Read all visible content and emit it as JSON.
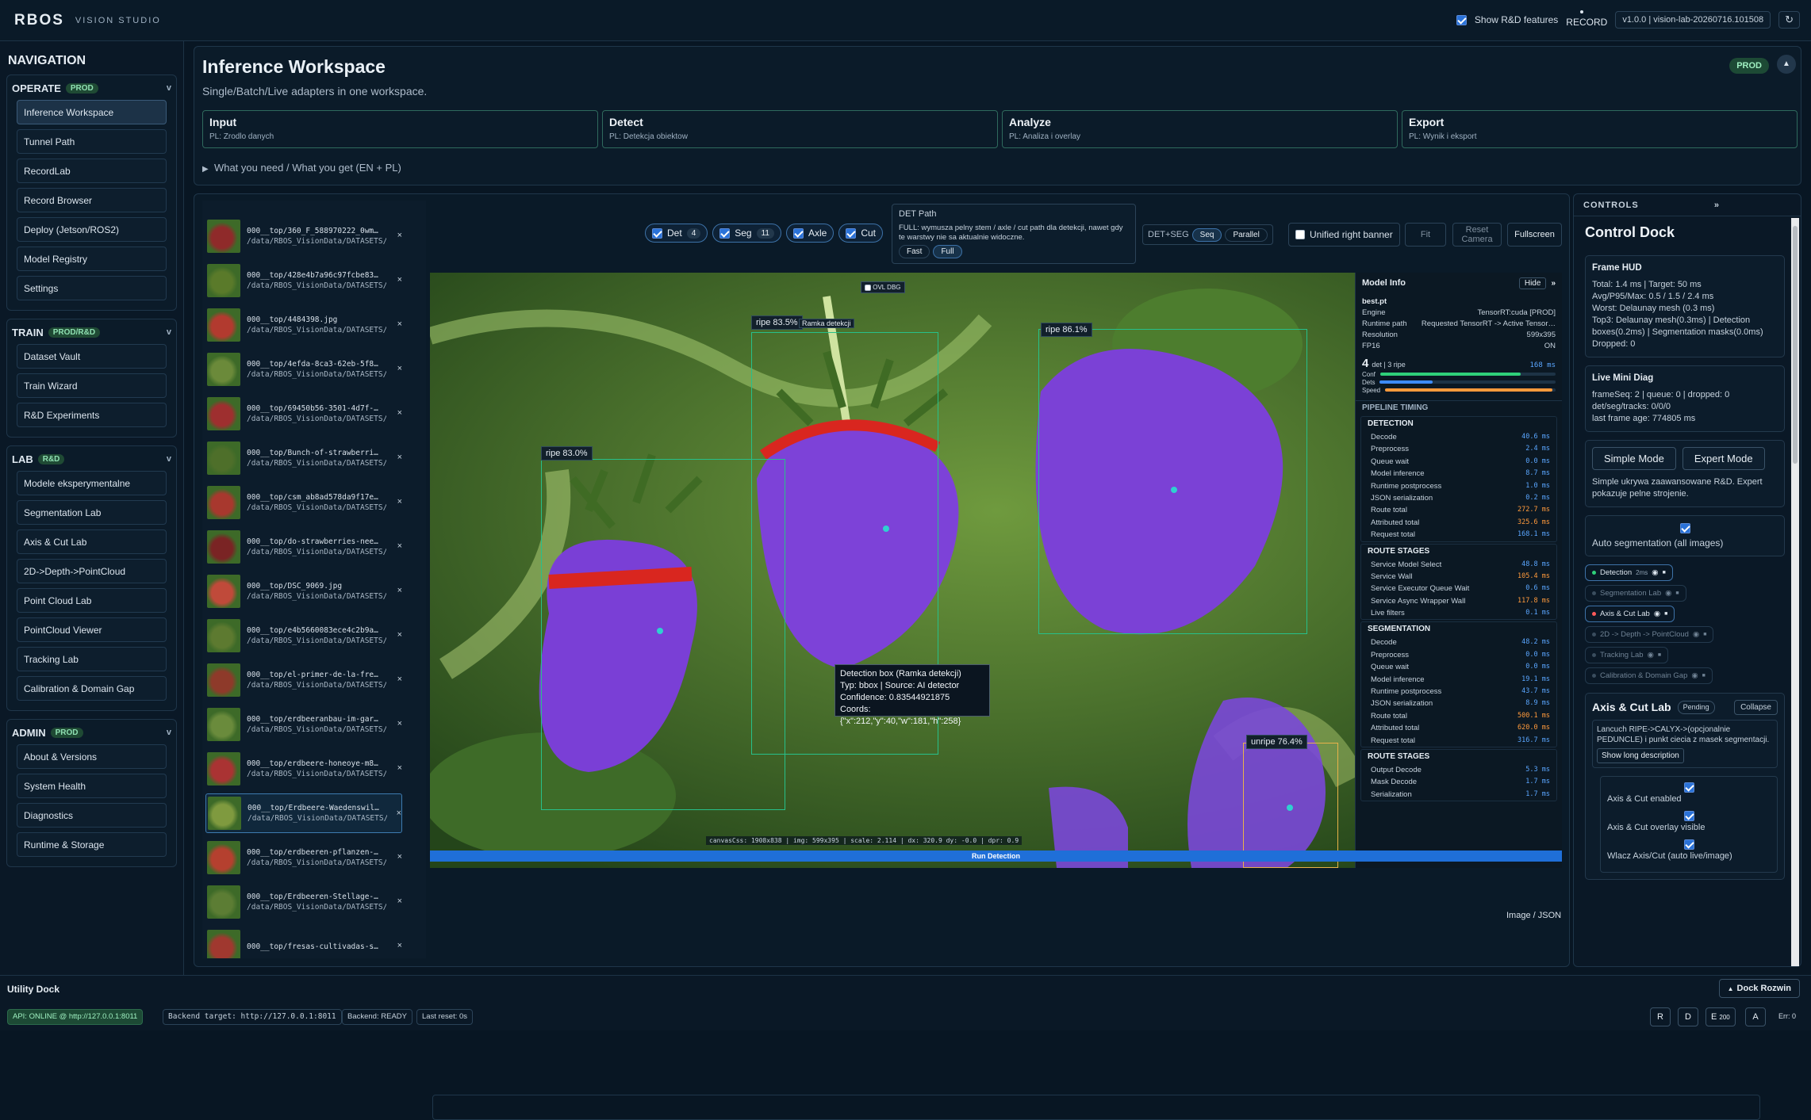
{
  "app": {
    "logo": "RBOS",
    "subtitle": "VISION STUDIO",
    "show_rd": "Show R&D features",
    "record": "RECORD",
    "version": "v1.0.0 | vision-lab-20260716.101508"
  },
  "nav": {
    "title": "NAVIGATION",
    "groups": [
      {
        "label": "OPERATE",
        "badge": "PROD",
        "items": [
          "Inference Workspace",
          "Tunnel Path",
          "RecordLab",
          "Record Browser",
          "Deploy (Jetson/ROS2)",
          "Model Registry",
          "Settings"
        ]
      },
      {
        "label": "TRAIN",
        "badge": "PROD/R&D",
        "items": [
          "Dataset Vault",
          "Train Wizard",
          "R&D Experiments"
        ]
      },
      {
        "label": "LAB",
        "badge": "R&D",
        "items": [
          "Modele eksperymentalne",
          "Segmentation Lab",
          "Axis & Cut Lab",
          "2D->Depth->PointCloud",
          "Point Cloud Lab",
          "PointCloud Viewer",
          "Tracking Lab",
          "Calibration & Domain Gap"
        ]
      },
      {
        "label": "ADMIN",
        "badge": "PROD",
        "items": [
          "About & Versions",
          "System Health",
          "Diagnostics",
          "Runtime & Storage"
        ]
      }
    ]
  },
  "workspace": {
    "title": "Inference Workspace",
    "subtitle": "Single/Batch/Live adapters in one workspace.",
    "badge": "PROD",
    "steps": [
      {
        "t": "Input",
        "s": "PL: Zrodlo danych"
      },
      {
        "t": "Detect",
        "s": "PL: Detekcja obiektow"
      },
      {
        "t": "Analyze",
        "s": "PL: Analiza i overlay"
      },
      {
        "t": "Export",
        "s": "PL: Wynik i eksport"
      }
    ],
    "details": "What you need / What you get (EN + PL)"
  },
  "files": [
    {
      "n": "000__top/360_F_588970222_0wm…",
      "p": "/data/RBOS_VisionData/DATASETS/…"
    },
    {
      "n": "000__top/428e4b7a96c97fcbe83…",
      "p": "/data/RBOS_VisionData/DATASETS/…"
    },
    {
      "n": "000__top/4484398.jpg",
      "p": "/data/RBOS_VisionData/DATASETS/…"
    },
    {
      "n": "000__top/4efda-8ca3-62eb-5f8…",
      "p": "/data/RBOS_VisionData/DATASETS/…"
    },
    {
      "n": "000__top/69450b56-3501-4d7f-…",
      "p": "/data/RBOS_VisionData/DATASETS/…"
    },
    {
      "n": "000__top/Bunch-of-strawberri…",
      "p": "/data/RBOS_VisionData/DATASETS/…"
    },
    {
      "n": "000__top/csm_ab8ad578da9f17e…",
      "p": "/data/RBOS_VisionData/DATASETS/…"
    },
    {
      "n": "000__top/do-strawberries-nee…",
      "p": "/data/RBOS_VisionData/DATASETS/…"
    },
    {
      "n": "000__top/DSC_9069.jpg",
      "p": "/data/RBOS_VisionData/DATASETS/…"
    },
    {
      "n": "000__top/e4b5660083ece4c2b9a…",
      "p": "/data/RBOS_VisionData/DATASETS/…"
    },
    {
      "n": "000__top/el-primer-de-la-fre…",
      "p": "/data/RBOS_VisionData/DATASETS/…"
    },
    {
      "n": "000__top/erdbeeranbau-im-gar…",
      "p": "/data/RBOS_VisionData/DATASETS/…"
    },
    {
      "n": "000__top/erdbeere-honeoye-m8…",
      "p": "/data/RBOS_VisionData/DATASETS/…"
    },
    {
      "n": "000__top/Erdbeere-Waedenswil…",
      "p": "/data/RBOS_VisionData/DATASETS/…"
    },
    {
      "n": "000__top/erdbeeren-pflanzen-…",
      "p": "/data/RBOS_VisionData/DATASETS/…"
    },
    {
      "n": "000__top/Erdbeeren-Stellage-…",
      "p": "/data/RBOS_VisionData/DATASETS/…"
    },
    {
      "n": "000__top/fresas-cultivadas-s…",
      "p": ""
    }
  ],
  "toolbar": {
    "det": "Det",
    "det_n": "4",
    "seg": "Seg",
    "seg_n": "11",
    "axle": "Axle",
    "cut": "Cut",
    "detpath_title": "DET Path",
    "detpath_desc": "FULL: wymusza pelny stem / axle / cut path dla detekcji, nawet gdy te warstwy nie sa aktualnie widoczne.",
    "fast": "Fast",
    "full": "Full",
    "mode": "DET+SEG",
    "seq": "Seq",
    "parallel": "Parallel",
    "unified": "Unified right banner",
    "fit": "Fit",
    "reset": "Reset Camera",
    "fullscreen": "Fullscreen"
  },
  "canvas": {
    "ovl": "OVL DBG",
    "labels": [
      "ripe 83.5%",
      "ripe 86.1%",
      "ripe 83.0%",
      "unripe 76.4%",
      "Ramka detekcji"
    ],
    "tooltip": [
      "Detection box (Ramka detekcji)",
      "Typ: bbox | Source: AI detector",
      "Confidence: 0.83544921875",
      "Coords: {\"x\":212,\"y\":40,\"w\":181,\"h\":258}"
    ],
    "diag": "canvasCss: 1908x838 | img: 599x395 | scale: 2.114 | dx: 320.9 dy: -0.0 | dpr: 0.9",
    "run": "Run Detection",
    "imgjson": "Image / JSON"
  },
  "model": {
    "title": "Model Info",
    "hide": "Hide",
    "file": "best.pt",
    "rows": [
      [
        "Engine",
        "TensorRT:cuda [PROD]"
      ],
      [
        "Runtime path",
        "Requested TensorRT -> Active Tensor…"
      ],
      [
        "Resolution",
        "599x395"
      ],
      [
        "FP16",
        "ON"
      ]
    ],
    "count": "4",
    "count_label": "det | 3 ripe",
    "count_ms": "168 ms",
    "bars": [
      "Conf",
      "Dets",
      "Speed"
    ],
    "pipeline": "PIPELINE TIMING",
    "detection": [
      [
        "Decode",
        "40.6 ms"
      ],
      [
        "Preprocess",
        "2.4 ms"
      ],
      [
        "Queue wait",
        "0.0 ms"
      ],
      [
        "Model inference",
        "8.7 ms"
      ],
      [
        "Runtime postprocess",
        "1.0 ms"
      ],
      [
        "JSON serialization",
        "0.2 ms"
      ],
      [
        "Route total",
        "272.7 ms"
      ],
      [
        "Attributed total",
        "325.6 ms"
      ],
      [
        "Request total",
        "168.1 ms"
      ]
    ],
    "route1": [
      [
        "Service Model Select",
        "48.8 ms"
      ],
      [
        "Service Wall",
        "105.4 ms"
      ],
      [
        "Service Executor Queue Wait",
        "0.6 ms"
      ],
      [
        "Service Async Wrapper Wall",
        "117.8 ms"
      ],
      [
        "Live filters",
        "0.1 ms"
      ]
    ],
    "segmentation": [
      [
        "Decode",
        "48.2 ms"
      ],
      [
        "Preprocess",
        "0.0 ms"
      ],
      [
        "Queue wait",
        "0.0 ms"
      ],
      [
        "Model inference",
        "19.1 ms"
      ],
      [
        "Runtime postprocess",
        "43.7 ms"
      ],
      [
        "JSON serialization",
        "8.9 ms"
      ],
      [
        "Route total",
        "500.1 ms"
      ],
      [
        "Attributed total",
        "620.0 ms"
      ],
      [
        "Request total",
        "316.7 ms"
      ]
    ],
    "route2": [
      [
        "Output Decode",
        "5.3 ms"
      ],
      [
        "Mask Decode",
        "1.7 ms"
      ],
      [
        "Serialization",
        "1.7 ms"
      ]
    ],
    "sec_det": "DETECTION",
    "sec_route": "ROUTE STAGES",
    "sec_seg": "SEGMENTATION"
  },
  "controls": {
    "head": "CONTROLS",
    "title": "Control Dock",
    "hud": {
      "t": "Frame HUD",
      "l": [
        "Total: 1.4 ms | Target: 50 ms",
        "Avg/P95/Max: 0.5 / 1.5 / 2.4 ms",
        "Worst: Delaunay mesh (0.3 ms)",
        "Top3: Delaunay mesh(0.3ms) | Detection boxes(0.2ms) | Segmentation masks(0.0ms)",
        "Dropped: 0"
      ]
    },
    "diag": {
      "t": "Live Mini Diag",
      "l": [
        "frameSeq: 2 | queue: 0 | dropped: 0",
        "det/seg/tracks: 0/0/0",
        "last frame age: 774805 ms"
      ]
    },
    "simple": "Simple Mode",
    "expert": "Expert Mode",
    "mode_desc": "Simple ukrywa zaawansowane R&D. Expert pokazuje pelne strojenie.",
    "autoseg": "Auto segmentation (all images)",
    "chips": [
      "Detection",
      "Segmentation Lab",
      "Axis & Cut Lab",
      "2D -> Depth -> PointCloud",
      "Tracking Lab",
      "Calibration & Domain Gap"
    ],
    "chip_ms": "2ms",
    "axis": {
      "t": "Axis & Cut Lab",
      "pending": "Pending",
      "collapse": "Collapse",
      "desc": "Lancuch RIPE->CALYX->(opcjonalnie PEDUNCLE) i punkt ciecia z masek segmentacji.",
      "long": "Show long description",
      "opts": [
        "Axis & Cut enabled",
        "Axis & Cut overlay visible",
        "Wlacz Axis/Cut (auto live/image)"
      ]
    }
  },
  "utility": {
    "title": "Utility Dock",
    "dock": "Dock Rozwin",
    "status": [
      "API: ONLINE @ http://127.0.0.1:8011",
      "Backend target: http://127.0.0.1:8011",
      "Backend: READY",
      "Last reset: 0s"
    ],
    "keys": [
      "R",
      "D",
      "E",
      "A"
    ],
    "e_n": "200",
    "err": "Err: 0"
  }
}
